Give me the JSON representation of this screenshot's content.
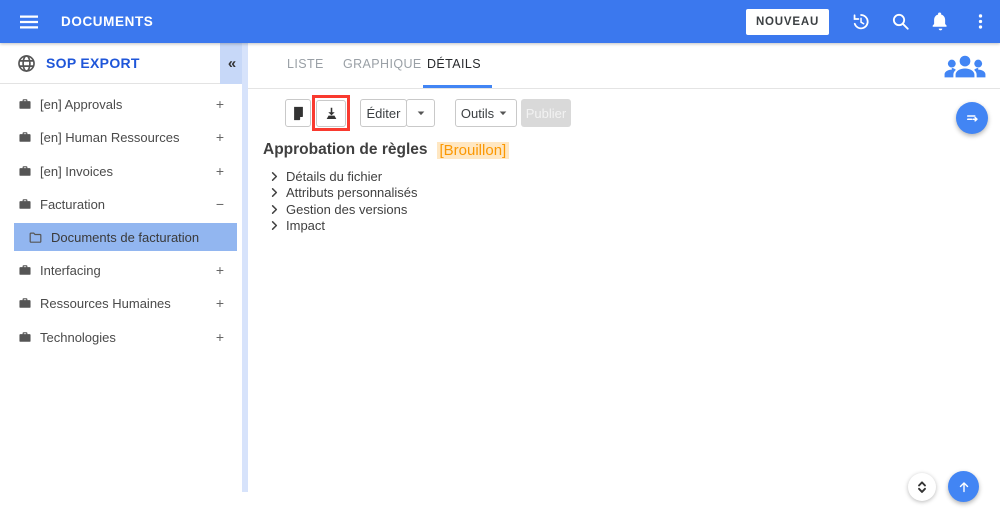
{
  "topbar": {
    "title": "DOCUMENTS",
    "new_button_label": "NOUVEAU"
  },
  "sidebar": {
    "title": "SOP EXPORT",
    "collapse_glyph": "«",
    "items": [
      {
        "label": "[en] Approvals",
        "expander": "+",
        "icon": "briefcase-icon",
        "selected": false
      },
      {
        "label": "[en] Human Ressources",
        "expander": "+",
        "icon": "briefcase-icon",
        "selected": false
      },
      {
        "label": "[en] Invoices",
        "expander": "+",
        "icon": "briefcase-icon",
        "selected": false
      },
      {
        "label": "Facturation",
        "expander": "−",
        "icon": "briefcase-icon",
        "selected": false
      },
      {
        "label": "Documents de facturation",
        "icon": "folder-icon",
        "selected": true
      },
      {
        "label": "Interfacing",
        "expander": "+",
        "icon": "briefcase-icon",
        "selected": false
      },
      {
        "label": "Ressources Humaines",
        "expander": "+",
        "icon": "briefcase-icon",
        "selected": false
      },
      {
        "label": "Technologies",
        "expander": "+",
        "icon": "briefcase-icon",
        "selected": false
      }
    ]
  },
  "tabs": [
    {
      "label": "LISTE",
      "active": false
    },
    {
      "label": "GRAPHIQUE",
      "active": false
    },
    {
      "label": "DÉTAILS",
      "active": true
    }
  ],
  "toolbar": {
    "edit_label": "Éditer",
    "tools_label": "Outils",
    "publish_label": "Publier",
    "publish_disabled": true,
    "highlighted_button": "download-button"
  },
  "document": {
    "title": "Approbation de règles",
    "status_badge": "[Brouillon]"
  },
  "sections": [
    {
      "label": "Détails du fichier",
      "collapsed": true
    },
    {
      "label": "Attributs personnalisés",
      "collapsed": true
    },
    {
      "label": "Gestion des versions",
      "collapsed": true
    },
    {
      "label": "Impact",
      "collapsed": true
    }
  ],
  "colors": {
    "topbar": "#3b78ee",
    "accent": "#4285f4",
    "sidebar_title": "#1f56d9",
    "selected_bg": "#92b6f0",
    "collapse_bg": "#c7d8f8",
    "stripe": "#d7e3fb",
    "annotation": "#f93a2f",
    "badge_text": "#fb9803",
    "badge_bg": "#ffe7c2"
  }
}
